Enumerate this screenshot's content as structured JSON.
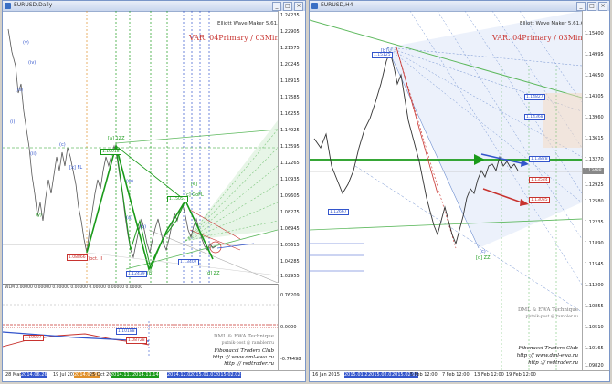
{
  "left": {
    "title": "EURUSD,Daily",
    "maker": "Elliott Wave Maker 5.61.6",
    "var": "VAR. 04Primary / 03Minute",
    "subwindow": "WLM 0.00000 0.00000 0.00000 0.00000 0.00000 0.00000 0.00000",
    "dml": "DML & EWA Technique",
    "dml_mail": "putnik-post @ rambler.ru",
    "fib_club": "Fibonacci Traders Club",
    "url1": "http :// www.dml-ewa.ru",
    "url2": "http :// redtrader.ru",
    "price_ticks": [
      "1.24235",
      "1.22905",
      "1.21575",
      "1.20245",
      "1.18915",
      "1.17585",
      "1.16255",
      "1.14925",
      "1.13595",
      "1.12265",
      "1.10935",
      "1.09605",
      "1.08275",
      "1.06945",
      "1.05615",
      "1.04285",
      "1.02955"
    ],
    "sub_ticks": [
      "0.76209",
      "0.0000",
      "-0.74498"
    ],
    "time_labels": [
      "28 Mar 2014",
      "2014.06.26",
      "19 Jul 2014",
      "2014.08.06",
      "25 Oct 2014",
      "2014.11.17",
      "2014.11.14",
      "2014.12.12",
      "2014.12.05",
      "2015.01.01",
      "2015.02.02",
      "2015.01.06"
    ],
    "price_boxes": [
      {
        "text": "1.10018",
        "color": "#1a9a1a"
      },
      {
        "text": "1.15057",
        "color": "#1a9a1a"
      },
      {
        "text": "1.08866",
        "color": "#c8332f"
      },
      {
        "text": "1.12439",
        "color": "#3355cc"
      },
      {
        "text": "1.13407",
        "color": "#3355cc"
      },
      {
        "text": "1.10007",
        "color": "#c8332f"
      },
      {
        "text": "1.08728",
        "color": "#c8332f"
      },
      {
        "text": "1.10188",
        "color": "#3355cc"
      }
    ],
    "wave_labels": [
      "(v)",
      "(iv)",
      "(iii)",
      "(i)",
      "(ii)",
      "[a] 1ZZ",
      "(c)",
      "(a)",
      "(b)",
      "[c] GoFL",
      "[b]",
      "[x] FL",
      "(y)",
      "[d] ZZ",
      "A (M)oct. II",
      "(w)",
      "[e]"
    ]
  },
  "right": {
    "title": "EURUSD,H4",
    "maker": "Elliott Wave Maker 5.61.6",
    "var": "VAR. 04Primary / 03Minute",
    "dml": "DML & EWA Technique",
    "dml_mail": "putnik-post @ rambler.ru",
    "fib_club": "Fibonacci Traders Club",
    "url1": "http :// www.dml-ewa.ru",
    "url2": "http :// redtrader.ru",
    "price_ticks": [
      "1.15400",
      "1.14995",
      "1.14650",
      "1.14305",
      "1.13960",
      "1.13615",
      "1.13270",
      "1.12925",
      "1.12580",
      "1.12235",
      "1.11890",
      "1.11545",
      "1.11200",
      "1.10855",
      "1.10510",
      "1.10165",
      "1.09820"
    ],
    "time_labels": [
      "16 Jan 2015",
      "2015.01.28",
      "2015.02.02",
      "2015.02.05",
      "5 Feb 12:00",
      "7 Feb 12:00",
      "13 Feb 12:00",
      "19 Feb 12:00"
    ],
    "price_boxes": [
      {
        "text": "1.15125",
        "color": "#3355cc"
      },
      {
        "text": "1.14827",
        "color": "#3355cc"
      },
      {
        "text": "1.14368",
        "color": "#3355cc"
      },
      {
        "text": "1.13828",
        "color": "#3355cc"
      },
      {
        "text": "1.13584",
        "color": "#c8332f"
      },
      {
        "text": "1.13085",
        "color": "#c8332f"
      },
      {
        "text": "1.12667",
        "color": "#3355cc"
      },
      {
        "text": "1.13488",
        "color": "#888888"
      }
    ],
    "wave_labels": [
      "[b]",
      "(c)",
      "[d] ZZ"
    ]
  }
}
